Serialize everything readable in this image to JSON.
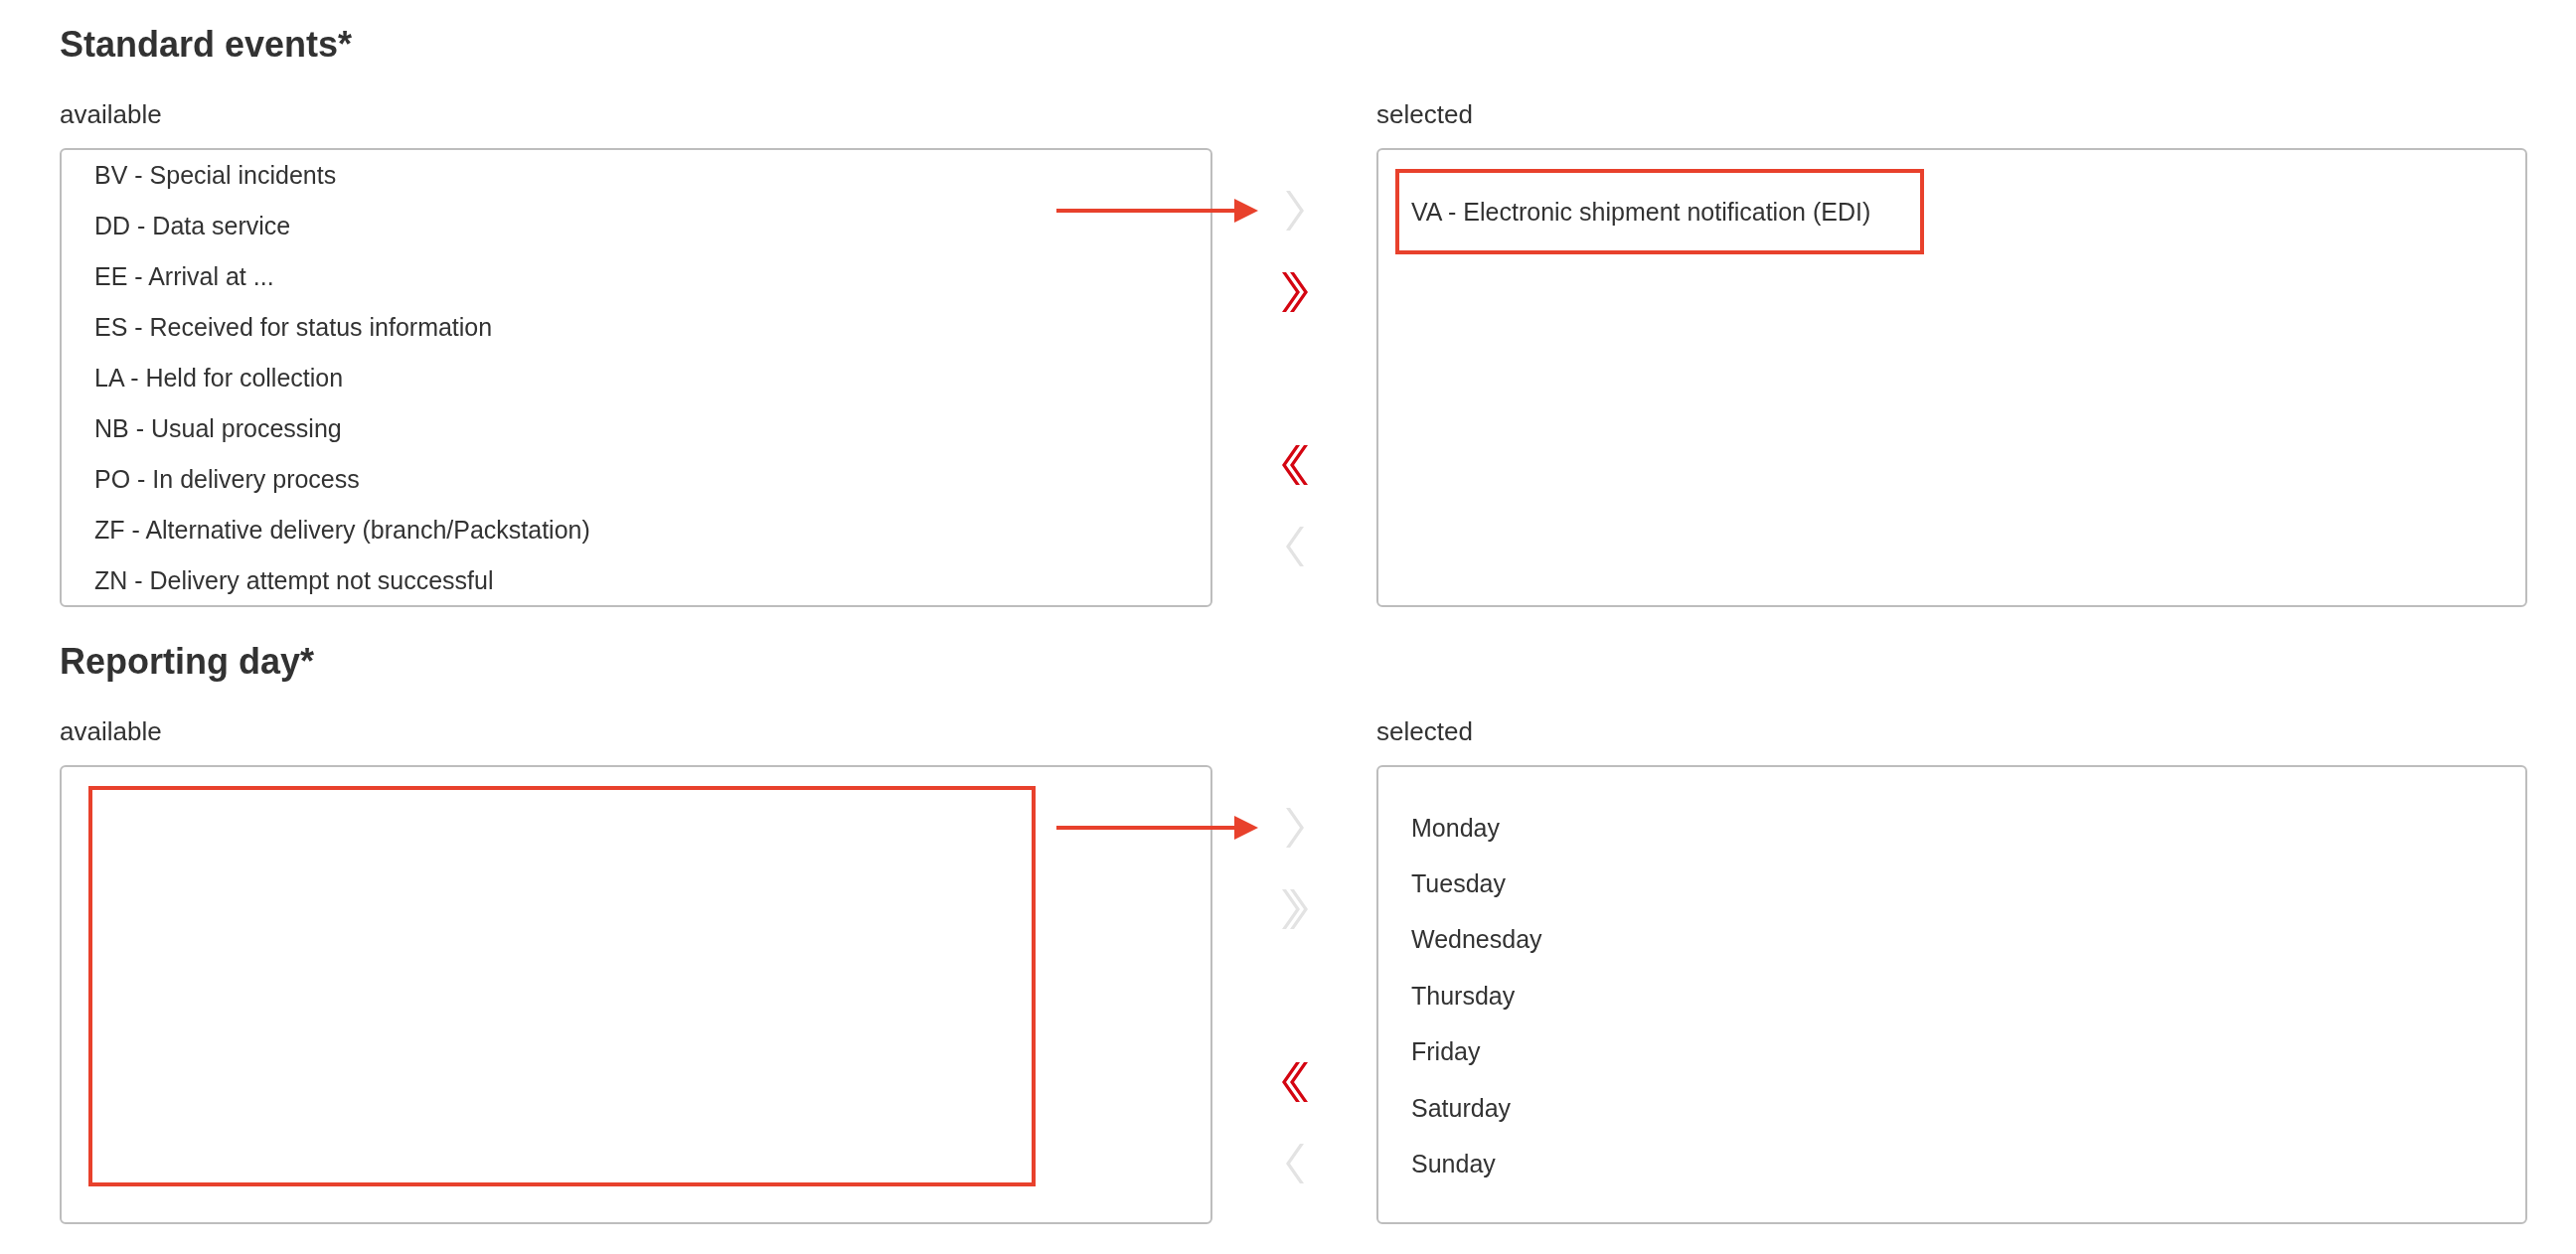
{
  "sections": [
    {
      "title": "Standard events*",
      "arrow": true,
      "available": {
        "label": "available",
        "scrolled": true,
        "framed": false,
        "items": [
          "BV - Special incidents",
          "DD - Data service",
          "EE - Arrival at ...",
          "ES - Received for status information",
          "LA - Held for collection",
          "NB - Usual processing",
          "PO - In delivery process",
          "ZF - Alternative delivery (branch/Packstation)",
          "ZN - Delivery attempt not successful"
        ]
      },
      "buttons": [
        {
          "kind": "add",
          "disabled": true
        },
        {
          "kind": "add_all",
          "disabled": false
        },
        {
          "kind": "remove_all",
          "disabled": false
        },
        {
          "kind": "remove",
          "disabled": true
        }
      ],
      "selected": {
        "label": "selected",
        "scrolled": false,
        "framed": true,
        "items": [
          "VA - Electronic shipment notification (EDI)"
        ]
      }
    },
    {
      "title": "Reporting day*",
      "arrow": true,
      "available": {
        "label": "available",
        "scrolled": false,
        "framed": true
      },
      "buttons": [
        {
          "kind": "add",
          "disabled": true
        },
        {
          "kind": "add_all",
          "disabled": true
        },
        {
          "kind": "remove_all",
          "disabled": false
        },
        {
          "kind": "remove",
          "disabled": true
        }
      ],
      "selected": {
        "label": "selected",
        "scrolled": false,
        "framed": false,
        "items": [
          "Monday",
          "Tuesday",
          "Wednesday",
          "Thursday",
          "Friday",
          "Saturday",
          "Sunday"
        ]
      }
    }
  ]
}
